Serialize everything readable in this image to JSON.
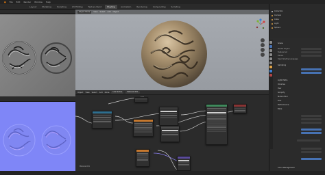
{
  "app": {
    "title": "Blender",
    "menu": [
      "File",
      "Edit",
      "Render",
      "Window",
      "Help"
    ]
  },
  "workspace_tabs": [
    {
      "label": "Layout",
      "active": false
    },
    {
      "label": "Modeling",
      "active": false
    },
    {
      "label": "Sculpting",
      "active": false
    },
    {
      "label": "UV Editing",
      "active": false
    },
    {
      "label": "Texture Paint",
      "active": false
    },
    {
      "label": "Shading",
      "active": true
    },
    {
      "label": "Animation",
      "active": false
    },
    {
      "label": "Rendering",
      "active": false
    },
    {
      "label": "Compositing",
      "active": false
    },
    {
      "label": "Scripting",
      "active": false
    }
  ],
  "viewport": {
    "mode_label": "Object Mode",
    "menus": [
      "View",
      "Select",
      "Add",
      "Object"
    ],
    "shading_label": "Material Preview"
  },
  "node_editor": {
    "menus": [
      "Object",
      "View",
      "Select",
      "Add",
      "Node"
    ],
    "use_nodes_label": "Use Nodes",
    "material_name": "Material.001",
    "footer_label": "Material.001"
  },
  "outliner": {
    "items": [
      {
        "label": "Collection",
        "color": "#c8c8c8"
      },
      {
        "label": "Camera",
        "color": "#e0a346"
      },
      {
        "label": "Cube",
        "color": "#e0a346"
      },
      {
        "label": "Light",
        "color": "#e0a346"
      },
      {
        "label": "Sphere",
        "color": "#e0a346"
      }
    ]
  },
  "properties": {
    "rows": [
      "Scene",
      "Render Engine",
      "Feature Set",
      "Device",
      "Open Shading Language",
      "Sampling",
      "Light Paths",
      "Volumes",
      "Hair",
      "Simplify",
      "Motion Blur",
      "Film",
      "Performance",
      "Bake",
      "Color Management"
    ]
  },
  "colors": {
    "accent": "#4772b3",
    "shader_header": "#3f8a5c",
    "texture_header": "#c6782e",
    "input_header": "#b04444",
    "vector_header": "#5a4a9c",
    "utility_header": "#4a4a4a",
    "output_header": "#8a3333"
  },
  "icons": {
    "gizmo": "axis-gizmo-icon",
    "camera": "camera-icon",
    "hand": "hand-icon",
    "zoom": "zoom-icon"
  }
}
